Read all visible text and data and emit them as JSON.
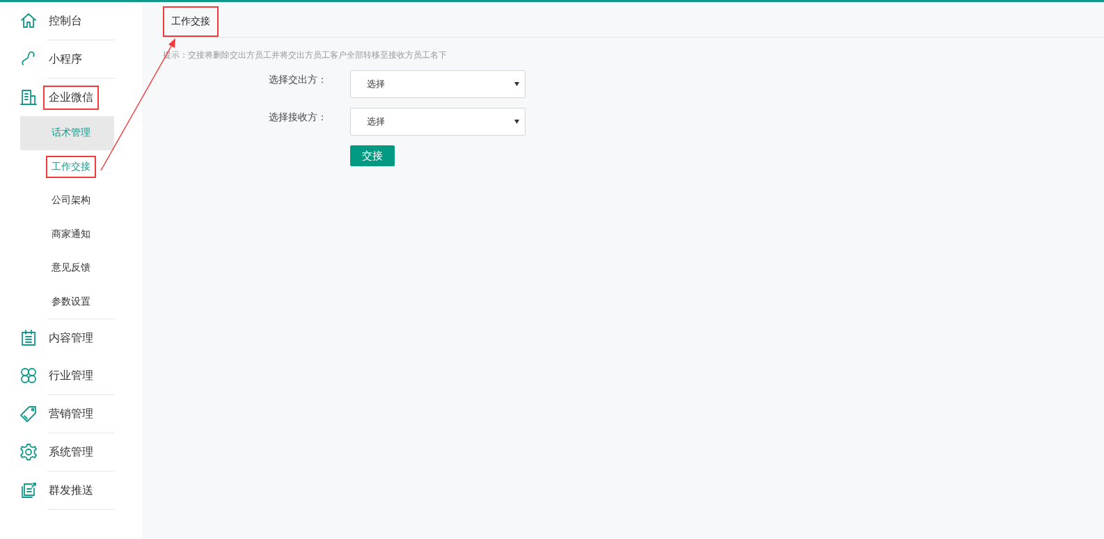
{
  "sidebar": {
    "items": [
      {
        "label": "控制台",
        "divider": true,
        "annotated": false
      },
      {
        "label": "小程序",
        "divider": true,
        "annotated": false
      },
      {
        "label": "企业微信",
        "divider": true,
        "annotated": true,
        "children": [
          {
            "label": "话术管理",
            "selected": true,
            "active": true,
            "annotated": false
          },
          {
            "label": "工作交接",
            "selected": false,
            "active": true,
            "annotated": true
          },
          {
            "label": "公司架构",
            "selected": false,
            "active": false,
            "annotated": false
          },
          {
            "label": "商家通知",
            "selected": false,
            "active": false,
            "annotated": false
          },
          {
            "label": "意见反馈",
            "selected": false,
            "active": false,
            "annotated": false
          },
          {
            "label": "参数设置",
            "selected": false,
            "active": false,
            "annotated": false
          }
        ]
      },
      {
        "label": "内容管理",
        "divider": false,
        "annotated": false
      },
      {
        "label": "行业管理",
        "divider": true,
        "annotated": false
      },
      {
        "label": "营销管理",
        "divider": true,
        "annotated": false
      },
      {
        "label": "系统管理",
        "divider": true,
        "annotated": false
      },
      {
        "label": "群发推送",
        "divider": true,
        "annotated": false
      }
    ]
  },
  "tabs": [
    {
      "label": "工作交接",
      "selected": true,
      "annotated": true
    }
  ],
  "hint": "提示：交接将删除交出方员工并将交出方员工客户全部转移至接收方员工名下",
  "form": {
    "fields": [
      {
        "label": "选择交出方：",
        "value": "选择"
      },
      {
        "label": "选择接收方：",
        "value": "选择"
      }
    ],
    "submit": "交接"
  },
  "annotation_arrow": true
}
